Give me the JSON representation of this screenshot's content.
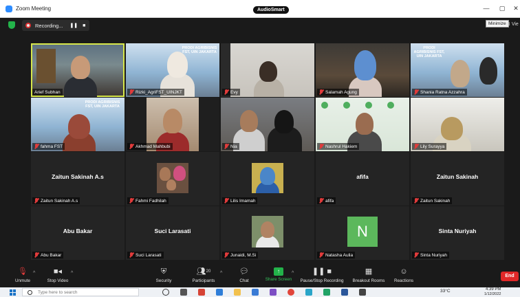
{
  "window": {
    "title": "Zoom Meeting",
    "badge": "AudioSmart",
    "minimize_tooltip": "Minimize",
    "view_label": "Vie"
  },
  "recording": {
    "label": "Recording...",
    "pause": "❚❚",
    "stop": "■"
  },
  "participants": [
    {
      "name": "Arief Subhan"
    },
    {
      "name": "Rizki_AgriFST_UINJKT",
      "slide": "PRODI AGRIBISNIS FST, UIN JAKARTA"
    },
    {
      "name": "Evy"
    },
    {
      "name": "Salamah Agung"
    },
    {
      "name": "Shania Ratna Azzahra",
      "slide": "PRODI AGRIBISNIS FST, UIN JAKARTA"
    },
    {
      "name": "fahma FST",
      "slide": "PRODI AGRIBISNIS FST, UIN JAKARTA"
    },
    {
      "name": "Akhmad Mahbubi"
    },
    {
      "name": "Nia"
    },
    {
      "name": "Nashrul Hakiem"
    },
    {
      "name": "Lily Surayya"
    },
    {
      "name": "Zaitun Sakinah A.s",
      "display": "Zaitun Sakinah A.s"
    },
    {
      "name": "Fahmi Fadhilah"
    },
    {
      "name": "Lilis Imamah"
    },
    {
      "name": "afifa",
      "display": "afifa"
    },
    {
      "name": "Zaitun Sakinah",
      "display": "Zaitun Sakinah"
    },
    {
      "name": "Abu Bakar",
      "display": "Abu Bakar"
    },
    {
      "name": "Suci Larasati",
      "display": "Suci Larasati"
    },
    {
      "name": "Junaidi, M.Si"
    },
    {
      "name": "Natasha Aulia",
      "avatar": "N"
    },
    {
      "name": "Sinta Nuriyah",
      "display": "Sinta Nuriyah"
    }
  ],
  "toolbar": {
    "unmute": "Unmute",
    "stop_video": "Stop Video",
    "security": "Security",
    "participants": "Participants",
    "participants_count": "20",
    "chat": "Chat",
    "share_screen": "Share Screen",
    "record": "Pause/Stop Recording",
    "breakout": "Breakout Rooms",
    "reactions": "Reactions",
    "end": "End"
  },
  "taskbar": {
    "search_placeholder": "Type here to search",
    "temp": "33°C",
    "time": "4:39 PM",
    "date": "1/12/2022"
  },
  "colors": {
    "accent_green": "#23b34a",
    "end_red": "#e02828",
    "mic_off": "#e03b3b",
    "active_speaker": "#d8e84a"
  }
}
